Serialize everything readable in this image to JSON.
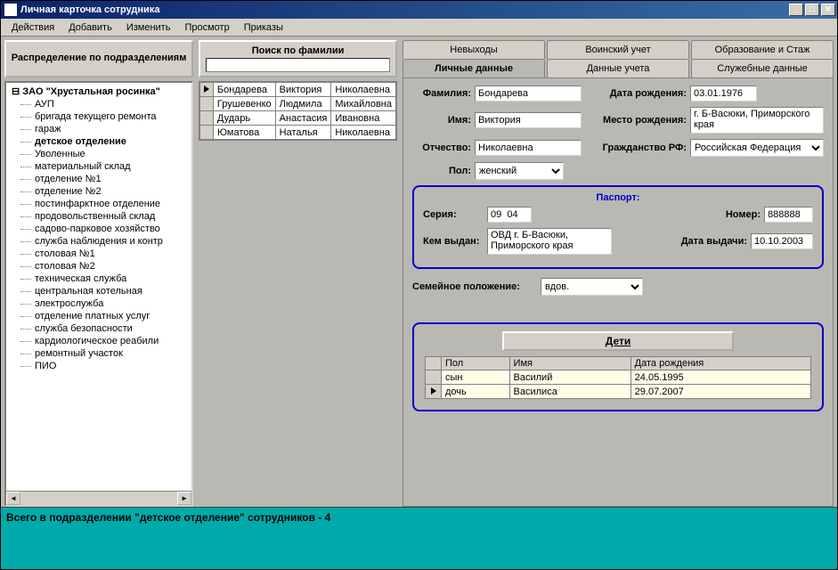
{
  "window": {
    "title": "Личная карточка сотрудника"
  },
  "menu": {
    "items": [
      "Действия",
      "Добавить",
      "Изменить",
      "Просмотр",
      "Приказы"
    ]
  },
  "left_panel": {
    "header": "Распределение по подразделениям",
    "root": "ЗАО \"Хрустальная росинка\"",
    "items": [
      "АУП",
      "бригада текущего ремонта",
      "гараж",
      "детское отделение",
      "Уволенные",
      "материальный склад",
      "отделение №1",
      "отделение №2",
      "постинфарктное отделение",
      "продовольственный склад",
      "садово-парковое хозяйство",
      "служба наблюдения и контр",
      "столовая №1",
      "столовая №2",
      "техническая служба",
      "центральная котельная",
      "электрослужба",
      "отделение платных услуг",
      "служба безопасности",
      "кардиологическое реабили",
      "ремонтный участок",
      "ПИО"
    ],
    "selected": 3
  },
  "search": {
    "header": "Поиск по фамилии",
    "value": ""
  },
  "employees": [
    {
      "last": "Бондарева",
      "first": "Виктория",
      "patr": "Николаевна"
    },
    {
      "last": "Грушевенко",
      "first": "Людмила",
      "patr": "Михайловна"
    },
    {
      "last": "Дударь",
      "first": "Анастасия",
      "patr": "Ивановна"
    },
    {
      "last": "Юматова",
      "first": "Наталья",
      "patr": "Николаевна"
    }
  ],
  "tabs_row1": [
    "Невыходы",
    "Воинский учет",
    "Образование и Стаж"
  ],
  "tabs_row2": [
    "Личные данные",
    "Данные учета",
    "Служебные данные"
  ],
  "tabs_active": "Личные данные",
  "form": {
    "labels": {
      "lastname": "Фамилия:",
      "firstname": "Имя:",
      "patronymic": "Отчество:",
      "sex": "Пол:",
      "birthdate": "Дата рождения:",
      "birthplace": "Место рождения:",
      "citizenship": "Гражданство РФ:",
      "marital": "Семейное положение:"
    },
    "lastname": "Бондарева",
    "firstname": "Виктория",
    "patronymic": "Николаевна",
    "sex": "женский",
    "birthdate": "03.01.1976",
    "birthplace": "г. Б-Васюки, Приморского края",
    "citizenship": "Российская Федерация",
    "marital": "вдов."
  },
  "passport": {
    "title": "Паспорт:",
    "labels": {
      "series": "Серия:",
      "number": "Номер:",
      "issued_by": "Кем выдан:",
      "issue_date": "Дата выдачи:"
    },
    "series": "09  04",
    "number": "888888",
    "issued_by": "ОВД г. Б-Васюки, Приморского края",
    "issue_date": "10.10.2003"
  },
  "children": {
    "button": "Дети",
    "headers": {
      "sex": "Пол",
      "name": "Имя",
      "dob": "Дата рождения"
    },
    "rows": [
      {
        "sex": "сын",
        "name": "Василий",
        "dob": "24.05.1995"
      },
      {
        "sex": "дочь",
        "name": "Василиса",
        "dob": "29.07.2007"
      }
    ]
  },
  "status": "Всего в подразделении \"детское отделение\" сотрудников - 4"
}
